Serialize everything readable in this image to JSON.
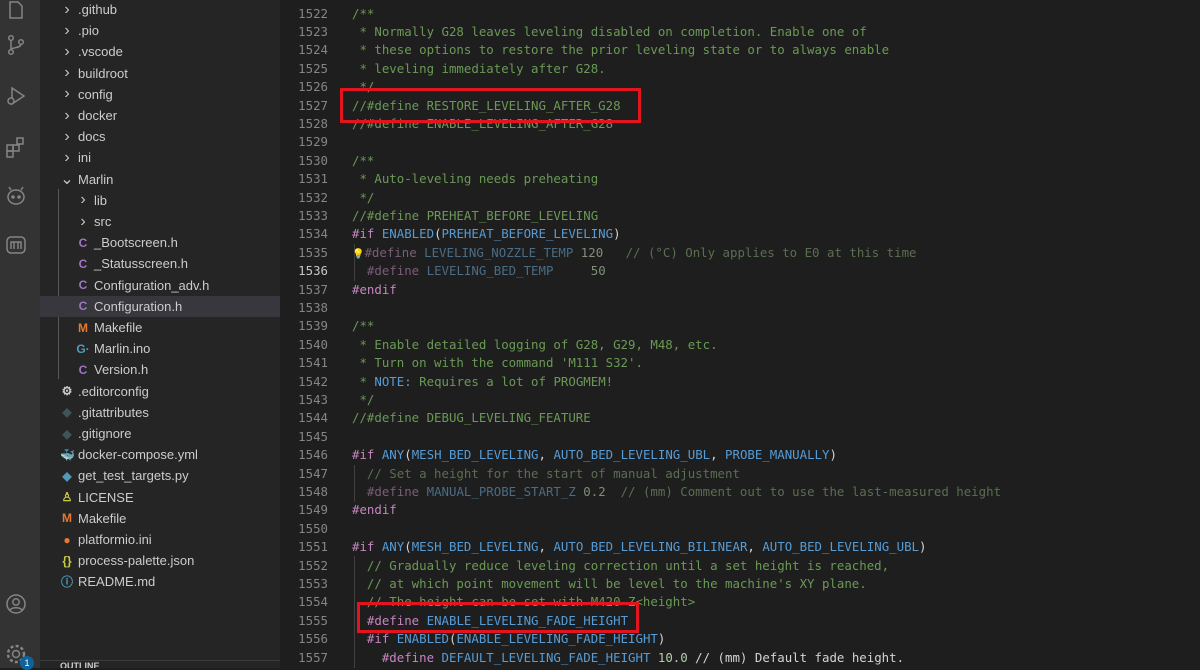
{
  "explorer": {
    "items": [
      {
        "label": ".github",
        "kind": "folder",
        "icon": "chevron-right-icon"
      },
      {
        "label": ".pio",
        "kind": "folder",
        "icon": "chevron-right-icon"
      },
      {
        "label": ".vscode",
        "kind": "folder",
        "icon": "chevron-right-icon"
      },
      {
        "label": "buildroot",
        "kind": "folder",
        "icon": "chevron-right-icon"
      },
      {
        "label": "config",
        "kind": "folder",
        "icon": "chevron-right-icon"
      },
      {
        "label": "docker",
        "kind": "folder",
        "icon": "chevron-right-icon"
      },
      {
        "label": "docs",
        "kind": "folder",
        "icon": "chevron-right-icon"
      },
      {
        "label": "ini",
        "kind": "folder",
        "icon": "chevron-right-icon"
      },
      {
        "label": "Marlin",
        "kind": "folder-open",
        "icon": "chevron-down-icon"
      },
      {
        "label": "lib",
        "kind": "folder",
        "icon": "chevron-right-icon"
      },
      {
        "label": "src",
        "kind": "folder",
        "icon": "chevron-right-icon"
      },
      {
        "label": "_Bootscreen.h",
        "kind": "c-file",
        "icon": "C"
      },
      {
        "label": "_Statusscreen.h",
        "kind": "c-file",
        "icon": "C"
      },
      {
        "label": "Configuration_adv.h",
        "kind": "c-file",
        "icon": "C"
      },
      {
        "label": "Configuration.h",
        "kind": "c-file",
        "icon": "C"
      },
      {
        "label": "Makefile",
        "kind": "make-file",
        "icon": "M"
      },
      {
        "label": "Marlin.ino",
        "kind": "ino-file",
        "icon": "G·"
      },
      {
        "label": "Version.h",
        "kind": "c-file",
        "icon": "C"
      },
      {
        "label": ".editorconfig",
        "kind": "config-file",
        "icon": "⚙"
      },
      {
        "label": ".gitattributes",
        "kind": "git-file",
        "icon": "◆"
      },
      {
        "label": ".gitignore",
        "kind": "git-file",
        "icon": "◆"
      },
      {
        "label": "docker-compose.yml",
        "kind": "docker-file",
        "icon": "🐳"
      },
      {
        "label": "get_test_targets.py",
        "kind": "py-file",
        "icon": "◆"
      },
      {
        "label": "LICENSE",
        "kind": "license-file",
        "icon": "♙"
      },
      {
        "label": "Makefile",
        "kind": "make-file",
        "icon": "M"
      },
      {
        "label": "platformio.ini",
        "kind": "pio-file",
        "icon": "●"
      },
      {
        "label": "process-palette.json",
        "kind": "json-file",
        "icon": "{}"
      },
      {
        "label": "README.md",
        "kind": "info-file",
        "icon": "ⓘ"
      }
    ],
    "footer_label": "OUTLINE"
  },
  "activity": {
    "badge_count": "1"
  },
  "editor": {
    "current_line": 1536,
    "lines": [
      {
        "n": "1522",
        "tokens": [
          {
            "t": "/**",
            "c": "t-comment"
          }
        ]
      },
      {
        "n": "1523",
        "tokens": [
          {
            "t": " * Normally G28 leaves leveling disabled on completion. Enable one of",
            "c": "t-comment"
          }
        ]
      },
      {
        "n": "1524",
        "tokens": [
          {
            "t": " * these options to restore the prior leveling state or to always enable",
            "c": "t-comment"
          }
        ]
      },
      {
        "n": "1525",
        "tokens": [
          {
            "t": " * leveling immediately after G28.",
            "c": "t-comment"
          }
        ]
      },
      {
        "n": "1526",
        "tokens": [
          {
            "t": " */",
            "c": "t-comment"
          }
        ]
      },
      {
        "n": "1527",
        "tokens": [
          {
            "t": "//#define RESTORE_LEVELING_AFTER_G28",
            "c": "t-comment"
          }
        ]
      },
      {
        "n": "1528",
        "tokens": [
          {
            "t": "//#define ENABLE_LEVELING_AFTER_G28",
            "c": "t-comment"
          }
        ]
      },
      {
        "n": "1529",
        "tokens": []
      },
      {
        "n": "1530",
        "tokens": [
          {
            "t": "/**",
            "c": "t-comment"
          }
        ]
      },
      {
        "n": "1531",
        "tokens": [
          {
            "t": " * Auto-leveling needs preheating",
            "c": "t-comment"
          }
        ]
      },
      {
        "n": "1532",
        "tokens": [
          {
            "t": " */",
            "c": "t-comment"
          }
        ]
      },
      {
        "n": "1533",
        "tokens": [
          {
            "t": "//#define PREHEAT_BEFORE_LEVELING",
            "c": "t-comment"
          }
        ]
      },
      {
        "n": "1534",
        "tokens": [
          {
            "t": "#if ",
            "c": "t-pp"
          },
          {
            "t": "ENABLED",
            "c": "t-macro"
          },
          {
            "t": "(",
            "c": "t-plain"
          },
          {
            "t": "PREHEAT_BEFORE_LEVELING",
            "c": "t-macro"
          },
          {
            "t": ")",
            "c": "t-plain"
          }
        ]
      },
      {
        "n": "1535",
        "tokens": [
          {
            "t": "💡",
            "c": "t-plain"
          },
          {
            "t": "#define ",
            "c": "t-ppdim"
          },
          {
            "t": "LEVELING_NOZZLE_TEMP",
            "c": "t-macrodim"
          },
          {
            "t": " 120",
            "c": "t-numdim"
          },
          {
            "t": "   // (°C) Only applies to E0 at this time",
            "c": "t-dim"
          }
        ]
      },
      {
        "n": "1536",
        "tokens": [
          {
            "t": "  #define ",
            "c": "t-ppdim"
          },
          {
            "t": "LEVELING_BED_TEMP",
            "c": "t-macrodim"
          },
          {
            "t": "     50",
            "c": "t-numdim"
          }
        ]
      },
      {
        "n": "1537",
        "tokens": [
          {
            "t": "#endif",
            "c": "t-pp"
          }
        ]
      },
      {
        "n": "1538",
        "tokens": []
      },
      {
        "n": "1539",
        "tokens": [
          {
            "t": "/**",
            "c": "t-comment"
          }
        ]
      },
      {
        "n": "1540",
        "tokens": [
          {
            "t": " * Enable detailed logging of G28, G29, M48, etc.",
            "c": "t-comment"
          }
        ]
      },
      {
        "n": "1541",
        "tokens": [
          {
            "t": " * Turn on with the command 'M111 S32'.",
            "c": "t-comment"
          }
        ]
      },
      {
        "n": "1542",
        "tokens": [
          {
            "t": " * ",
            "c": "t-comment"
          },
          {
            "t": "NOTE:",
            "c": "t-note"
          },
          {
            "t": " Requires a lot of PROGMEM!",
            "c": "t-comment"
          }
        ]
      },
      {
        "n": "1543",
        "tokens": [
          {
            "t": " */",
            "c": "t-comment"
          }
        ]
      },
      {
        "n": "1544",
        "tokens": [
          {
            "t": "//#define DEBUG_LEVELING_FEATURE",
            "c": "t-comment"
          }
        ]
      },
      {
        "n": "1545",
        "tokens": []
      },
      {
        "n": "1546",
        "tokens": [
          {
            "t": "#if ",
            "c": "t-pp"
          },
          {
            "t": "ANY",
            "c": "t-macro"
          },
          {
            "t": "(",
            "c": "t-plain"
          },
          {
            "t": "MESH_BED_LEVELING",
            "c": "t-macro"
          },
          {
            "t": ", ",
            "c": "t-plain"
          },
          {
            "t": "AUTO_BED_LEVELING_UBL",
            "c": "t-macro"
          },
          {
            "t": ", ",
            "c": "t-plain"
          },
          {
            "t": "PROBE_MANUALLY",
            "c": "t-macro"
          },
          {
            "t": ")",
            "c": "t-plain"
          }
        ]
      },
      {
        "n": "1547",
        "tokens": [
          {
            "t": "  // Set a height for the start of manual adjustment",
            "c": "t-dim"
          }
        ]
      },
      {
        "n": "1548",
        "tokens": [
          {
            "t": "  #define ",
            "c": "t-ppdim"
          },
          {
            "t": "MANUAL_PROBE_START_Z",
            "c": "t-macrodim"
          },
          {
            "t": " 0.2",
            "c": "t-numdim"
          },
          {
            "t": "  // (mm) Comment out to use the last-measured height",
            "c": "t-dim"
          }
        ]
      },
      {
        "n": "1549",
        "tokens": [
          {
            "t": "#endif",
            "c": "t-pp"
          }
        ]
      },
      {
        "n": "1550",
        "tokens": []
      },
      {
        "n": "1551",
        "tokens": [
          {
            "t": "#if ",
            "c": "t-pp"
          },
          {
            "t": "ANY",
            "c": "t-macro"
          },
          {
            "t": "(",
            "c": "t-plain"
          },
          {
            "t": "MESH_BED_LEVELING",
            "c": "t-macro"
          },
          {
            "t": ", ",
            "c": "t-plain"
          },
          {
            "t": "AUTO_BED_LEVELING_BILINEAR",
            "c": "t-macro"
          },
          {
            "t": ", ",
            "c": "t-plain"
          },
          {
            "t": "AUTO_BED_LEVELING_UBL",
            "c": "t-macro"
          },
          {
            "t": ")",
            "c": "t-plain"
          }
        ]
      },
      {
        "n": "1552",
        "tokens": [
          {
            "t": "  // Gradually reduce leveling correction until a set height is reached,",
            "c": "t-comment"
          }
        ]
      },
      {
        "n": "1553",
        "tokens": [
          {
            "t": "  // at which point movement will be level to the machine's XY plane.",
            "c": "t-comment"
          }
        ]
      },
      {
        "n": "1554",
        "tokens": [
          {
            "t": "  // The height can be set with M420 Z<height>",
            "c": "t-comment"
          }
        ]
      },
      {
        "n": "1555",
        "tokens": [
          {
            "t": "  #define ",
            "c": "t-pp"
          },
          {
            "t": "ENABLE_LEVELING_FADE_HEIGHT",
            "c": "t-macro"
          }
        ]
      },
      {
        "n": "1556",
        "tokens": [
          {
            "t": "  #if ",
            "c": "t-pp"
          },
          {
            "t": "ENABLED",
            "c": "t-macro"
          },
          {
            "t": "(",
            "c": "t-plain"
          },
          {
            "t": "ENABLE_LEVELING_FADE_HEIGHT",
            "c": "t-macro"
          },
          {
            "t": ")",
            "c": "t-plain"
          }
        ]
      },
      {
        "n": "1557",
        "tokens": [
          {
            "t": "    #define ",
            "c": "t-pp"
          },
          {
            "t": "DEFAULT_LEVELING_FADE_HEIGHT",
            "c": "t-macro"
          },
          {
            "t": " 10.0",
            "c": "t-num"
          },
          {
            "t": " // (mm) Default fade height.",
            "c": "t-plain"
          }
        ]
      }
    ]
  },
  "colors": {
    "highlight_box": "#e3141e",
    "accent": "#0e639c"
  }
}
